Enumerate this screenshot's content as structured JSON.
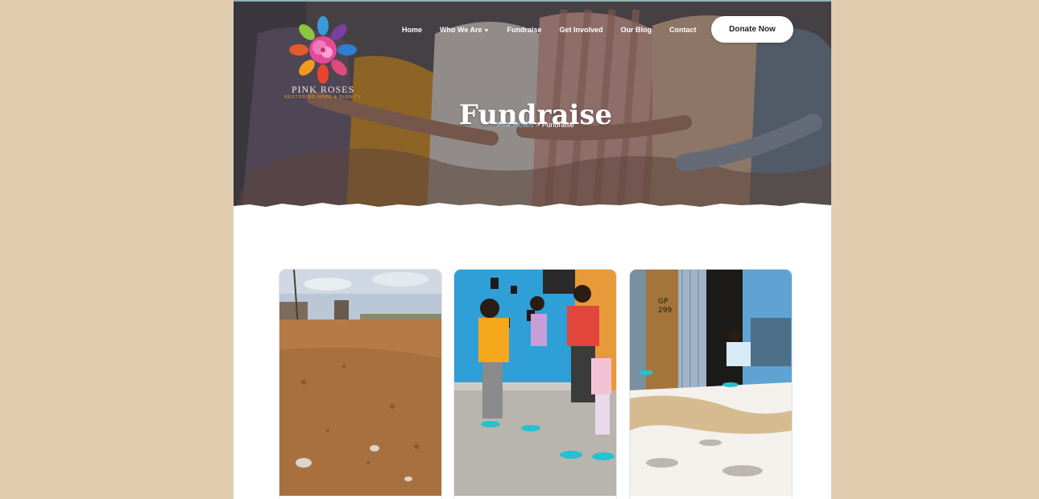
{
  "brand": {
    "name": "PINK ROSES",
    "tagline": "RESTORING HOPE & DIGNITY"
  },
  "nav": {
    "items": [
      {
        "label": "Home"
      },
      {
        "label": "Who We Are"
      },
      {
        "label": "Fundraise"
      },
      {
        "label": "Get Involved"
      },
      {
        "label": "Our Blog"
      },
      {
        "label": "Contact"
      }
    ],
    "donate_label": "Donate Now"
  },
  "hero": {
    "title": "Fundraise",
    "breadcrumb": {
      "home": "Pink Roses",
      "separator": ">",
      "current": "Fundraise"
    }
  },
  "cards": [
    {
      "image": "dusty-open-field-photo"
    },
    {
      "image": "children-playing-photo"
    },
    {
      "image": "corrugated-shack-doorway-photo"
    }
  ],
  "colors": {
    "page_background": "#e2ccb0",
    "content_background": "#ffffff",
    "breadcrumb_link": "#8fc1d3",
    "brand_accent": "#e0a43a"
  }
}
